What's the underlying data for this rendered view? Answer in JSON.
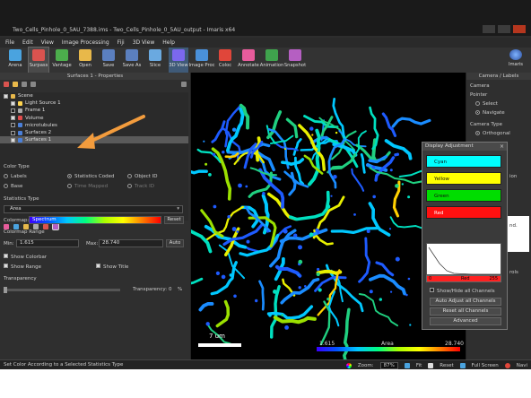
{
  "window": {
    "title": "Two_Cells_Pinhole_0_5AU_7388.ims - Two_Cells_Pinhole_0_5AU_output - Imaris x64"
  },
  "menu": [
    "File",
    "Edit",
    "View",
    "Image Processing",
    "Fiji",
    "3D View",
    "Help"
  ],
  "toolbar": [
    {
      "label": "Arena",
      "icon": "arena-icon",
      "color": "#4aa3df"
    },
    {
      "label": "Surpass",
      "icon": "surpass-icon",
      "color": "#d9534f"
    },
    {
      "label": "Vantage",
      "icon": "vantage-icon",
      "color": "#4cae4c"
    },
    {
      "label": "Open",
      "icon": "open-folder-icon",
      "color": "#e8b84a"
    },
    {
      "label": "Save",
      "icon": "save-icon",
      "color": "#5b7fbf"
    },
    {
      "label": "Save As",
      "icon": "save-as-icon",
      "color": "#5b7fbf"
    },
    {
      "label": "Slice",
      "icon": "slice-icon",
      "color": "#6aa9e0"
    },
    {
      "label": "3D View",
      "icon": "3d-view-icon",
      "color": "#7b68ee"
    },
    {
      "label": "Image Proc",
      "icon": "image-proc-icon",
      "color": "#4a90d9"
    },
    {
      "label": "Coloc",
      "icon": "coloc-icon",
      "color": "#e0463a"
    },
    {
      "label": "Annotate",
      "icon": "annotate-icon",
      "color": "#e85c9c"
    },
    {
      "label": "Animation",
      "icon": "animation-icon",
      "color": "#3fa34d"
    },
    {
      "label": "Snapshot",
      "icon": "snapshot-icon",
      "color": "#b55fc2"
    }
  ],
  "toolbar_right": {
    "label": "Imaris",
    "icon": "imaris-logo-icon"
  },
  "properties": {
    "header": "Surfaces 1 - Properties",
    "tree": [
      {
        "label": "Scene",
        "icon": "folder-icon",
        "color": "#e8b84a",
        "checked": true,
        "indent": 0
      },
      {
        "label": "Light Source 1",
        "icon": "light-icon",
        "color": "#ffd54f",
        "checked": true,
        "indent": 1
      },
      {
        "label": "Frame 1",
        "icon": "frame-icon",
        "color": "#aaaaaa",
        "checked": false,
        "indent": 1
      },
      {
        "label": "Volume",
        "icon": "volume-icon",
        "color": "#e04a4a",
        "checked": true,
        "indent": 1
      },
      {
        "label": "microtubules",
        "icon": "surface-icon",
        "color": "#4a7fd9",
        "checked": false,
        "indent": 1
      },
      {
        "label": "Surfaces 2",
        "icon": "surface-icon",
        "color": "#4a7fd9",
        "checked": false,
        "indent": 1
      },
      {
        "label": "Surfaces 1",
        "icon": "surface-icon",
        "color": "#4a7fd9",
        "checked": true,
        "indent": 1,
        "selected": true
      }
    ],
    "color_type_label": "Color Type",
    "color_type_options": [
      {
        "label": "Labels",
        "selected": false,
        "dim": false
      },
      {
        "label": "Statistics Coded",
        "selected": true,
        "dim": false
      },
      {
        "label": "Object ID",
        "selected": false,
        "dim": false
      },
      {
        "label": "Base",
        "selected": false,
        "dim": false
      },
      {
        "label": "Time Mapped",
        "selected": false,
        "dim": true
      },
      {
        "label": "Track ID",
        "selected": false,
        "dim": true
      }
    ],
    "statistics_type_label": "Statistics Type",
    "statistics_value": "Area",
    "colormap_label": "Colormap:",
    "colormap_value": "Spectrum",
    "reset_label": "Reset",
    "colormap_range_label": "Colormap Range",
    "min_label": "Min:",
    "min_value": "1.615",
    "max_label": "Max:",
    "max_value": "28.740",
    "auto_label": "Auto",
    "show_colorbar": "Show Colorbar",
    "show_range": "Show Range",
    "show_title": "Show Title",
    "transparency_label": "Transparency",
    "transparency_text": "Transparency:",
    "transparency_value": "0",
    "transparency_unit": "%"
  },
  "viewer": {
    "scale_label": "7 um",
    "colorbar_min": "1.615",
    "colorbar_title": "Area",
    "colorbar_max": "28.740"
  },
  "display_adjustment": {
    "title": "Display Adjustment",
    "channels": [
      {
        "label": "Cyan",
        "color": "#00ffff"
      },
      {
        "label": "Yellow",
        "color": "#ffff00"
      },
      {
        "label": "Green",
        "color": "#00dd00"
      },
      {
        "label": "Red",
        "color": "#ff1010"
      }
    ],
    "selected_channel": "Red",
    "range_min": "0",
    "range_max": "255",
    "show_hide": "Show/Hide all Channels",
    "auto_adjust": "Auto Adjust all Channels",
    "reset_channels": "Reset all Channels",
    "advanced": "Advanced"
  },
  "right_panel": {
    "header": "Camera / Labels",
    "camera_label": "Camera",
    "pointer_label": "Pointer",
    "select_label": "Select",
    "navigate_label": "Navigate",
    "camera_type_label": "Camera Type",
    "orthogonal_label": "Orthogonal",
    "partial_text_1": "nd.",
    "partial_text_2": "ion",
    "partial_text_3": "rols"
  },
  "status": {
    "message": "Set Color According to a Selected Statistics Type",
    "zoom_label": "Zoom:",
    "zoom_value": "87%",
    "fit_label": "Fit",
    "reset_label": "Reset",
    "fullscreen_label": "Full Screen",
    "navi_label": "Navi"
  }
}
